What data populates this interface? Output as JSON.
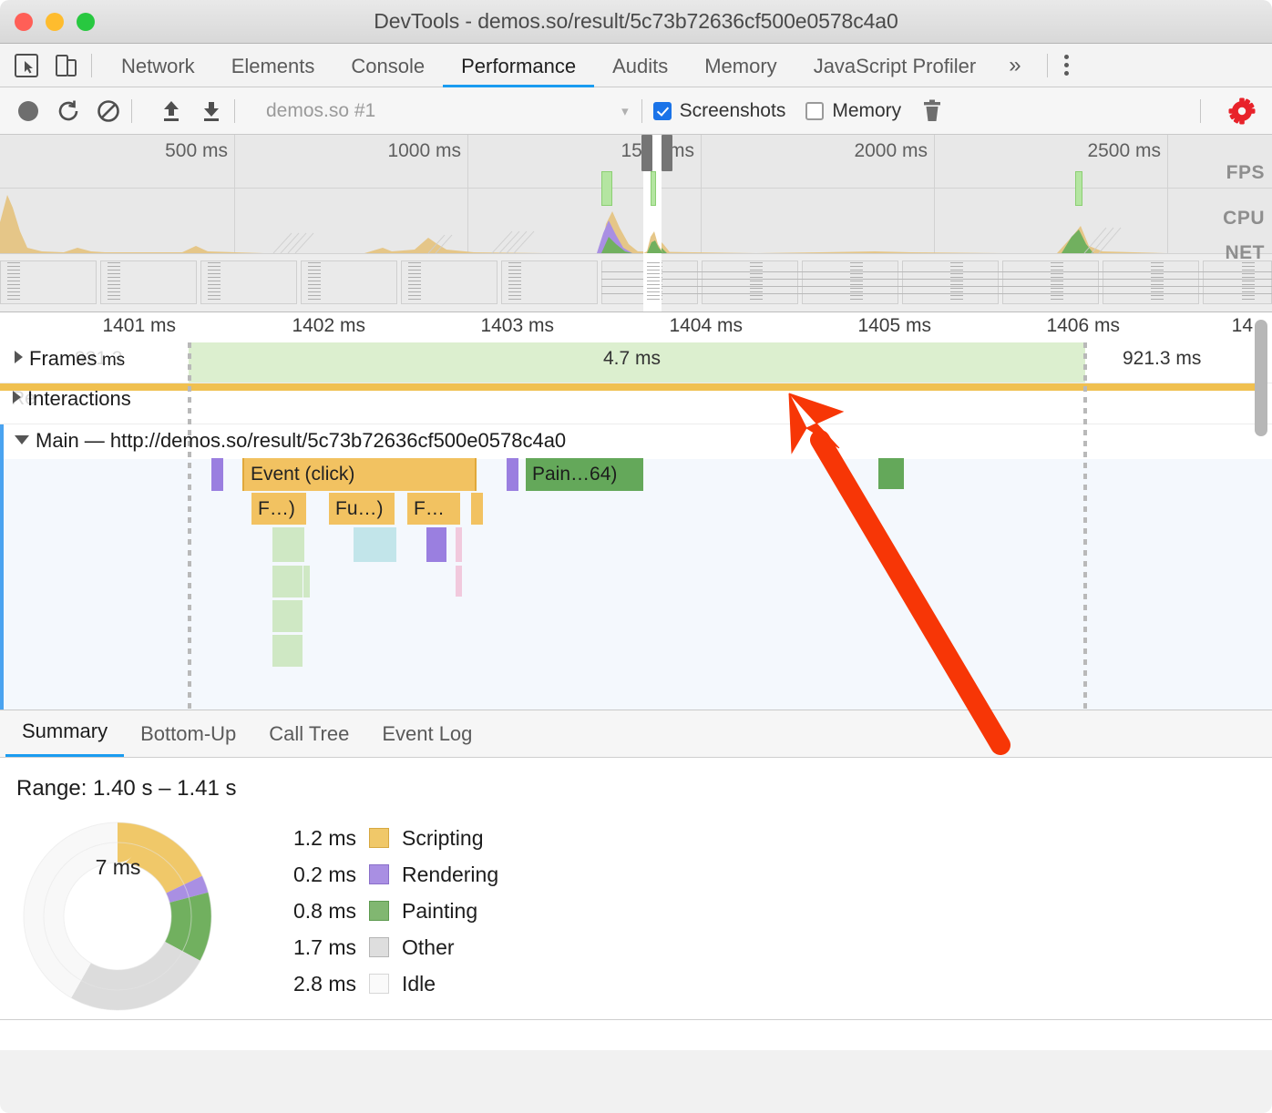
{
  "window": {
    "title": "DevTools - demos.so/result/5c73b72636cf500e0578c4a0",
    "traffic_colors": {
      "close": "#ff5f57",
      "minimize": "#febc2e",
      "zoom": "#28c840"
    }
  },
  "devtools_tabs": {
    "inspect_icon": "cursor-select-icon",
    "device_icon": "device-toolbar-icon",
    "items": [
      {
        "label": "Network",
        "active": false
      },
      {
        "label": "Elements",
        "active": false
      },
      {
        "label": "Console",
        "active": false
      },
      {
        "label": "Performance",
        "active": true
      },
      {
        "label": "Audits",
        "active": false
      },
      {
        "label": "Memory",
        "active": false
      },
      {
        "label": "JavaScript Profiler",
        "active": false
      }
    ],
    "more_label": "»",
    "menu_icon": "kebab-menu-icon"
  },
  "record_toolbar": {
    "record_icon": "record-circle-icon",
    "reload_icon": "reload-record-icon",
    "clear_icon": "clear-icon",
    "load_icon": "upload-profile-icon",
    "save_icon": "download-profile-icon",
    "session_name": "demos.so #1",
    "session_caret": "▾",
    "screenshots_label": "Screenshots",
    "screenshots_checked": true,
    "memory_label": "Memory",
    "memory_checked": false,
    "trash_icon": "trash-icon",
    "settings_icon": "gear-icon",
    "settings_color": "#e8222a"
  },
  "overview": {
    "ticks": [
      "500 ms",
      "1000 ms",
      "1500 ms",
      "2000 ms",
      "2500 ms"
    ],
    "track_labels": [
      "FPS",
      "CPU",
      "NET"
    ],
    "selection_start_ms": 1400,
    "selection_end_ms": 1410
  },
  "timeline": {
    "ruler_ticks": [
      "1401 ms",
      "1402 ms",
      "1403 ms",
      "1404 ms",
      "1405 ms",
      "1406 ms",
      "14"
    ],
    "frames": {
      "label": "Frames",
      "ghost_label": "921.3",
      "suffix": "ms",
      "duration_inside": "4.7 ms",
      "duration_after": "921.3 ms",
      "expander": "▶"
    },
    "interactions": {
      "label": "Interactions",
      "ghost_prefix": "Re",
      "expander": "▶",
      "band_color": "#f0c050"
    },
    "main": {
      "label": "Main — http://demos.so/result/5c73b72636cf500e0578c4a0",
      "expander": "▼"
    },
    "events": [
      {
        "label": "Event (click)",
        "category": "scripting",
        "depth": 0
      },
      {
        "label": "Pain…64)",
        "category": "painting",
        "depth": 0
      },
      {
        "label": "F…)",
        "category": "scripting",
        "depth": 1
      },
      {
        "label": "Fu…)",
        "category": "scripting",
        "depth": 1
      },
      {
        "label": "F…",
        "category": "scripting",
        "depth": 1
      }
    ]
  },
  "bottom_tabs": {
    "items": [
      {
        "label": "Summary",
        "active": true
      },
      {
        "label": "Bottom-Up",
        "active": false
      },
      {
        "label": "Call Tree",
        "active": false
      },
      {
        "label": "Event Log",
        "active": false
      }
    ]
  },
  "summary": {
    "range_label": "Range: 1.40 s – 1.41 s",
    "total": "7 ms"
  },
  "chart_data": {
    "type": "pie",
    "title": "Range: 1.40 s – 1.41 s",
    "center_label": "7 ms",
    "categories": [
      "Scripting",
      "Rendering",
      "Painting",
      "Other",
      "Idle"
    ],
    "values": [
      1.2,
      0.2,
      0.8,
      1.7,
      2.8
    ],
    "value_labels": [
      "1.2 ms",
      "0.2 ms",
      "0.8 ms",
      "1.7 ms",
      "2.8 ms"
    ],
    "colors": [
      "#f0c869",
      "#a98fe3",
      "#71b05f",
      "#dcdcdc",
      "#f8f8f8"
    ],
    "unit": "ms",
    "legend_position": "right",
    "donut": true
  }
}
